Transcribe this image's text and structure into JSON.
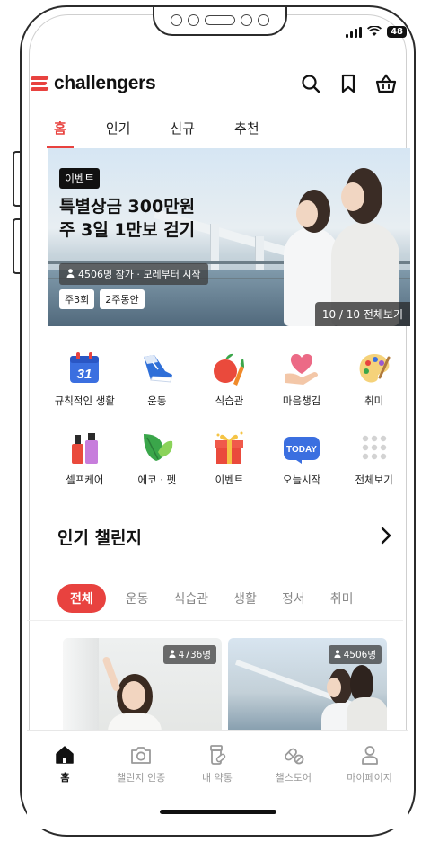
{
  "status": {
    "battery": "48"
  },
  "header": {
    "logo_text": "challengers",
    "brand_color": "#e8423f",
    "icons": [
      "search-icon",
      "bookmark-icon",
      "basket-icon"
    ]
  },
  "tabs": [
    {
      "label": "홈",
      "active": true
    },
    {
      "label": "인기"
    },
    {
      "label": "신규"
    },
    {
      "label": "추천"
    }
  ],
  "banner": {
    "tag": "이벤트",
    "title_line1": "특별상금 300만원",
    "title_line2": "주 3일 1만보 걷기",
    "meta": "4506명 참가 · 모레부터 시작",
    "chips": [
      "주3회",
      "2주동안"
    ],
    "page_indicator": "10 / 10 전체보기"
  },
  "categories": [
    {
      "label": "규칙적인 생활",
      "icon": "calendar-icon",
      "calendar_day": "31"
    },
    {
      "label": "운동",
      "icon": "sneaker-icon"
    },
    {
      "label": "식습관",
      "icon": "apple-carrot-icon"
    },
    {
      "label": "마음챙김",
      "icon": "heart-hand-icon"
    },
    {
      "label": "취미",
      "icon": "palette-icon"
    },
    {
      "label": "셀프케어",
      "icon": "cosmetics-icon"
    },
    {
      "label": "에코 · 펫",
      "icon": "leaves-icon"
    },
    {
      "label": "이벤트",
      "icon": "gift-icon"
    },
    {
      "label": "오늘시작",
      "icon": "today-badge-icon",
      "badge_text": "TODAY"
    },
    {
      "label": "전체보기",
      "icon": "grid-dots-icon"
    }
  ],
  "popular": {
    "title": "인기 챌린지",
    "filters": [
      {
        "label": "전체",
        "active": true
      },
      {
        "label": "운동"
      },
      {
        "label": "식습관"
      },
      {
        "label": "생활"
      },
      {
        "label": "정서"
      },
      {
        "label": "취미"
      }
    ],
    "cards": [
      {
        "count": "4736명"
      },
      {
        "count": "4506명"
      }
    ]
  },
  "bottom_nav": [
    {
      "label": "홈",
      "icon": "home-icon",
      "active": true
    },
    {
      "label": "챌린지 인증",
      "icon": "camera-icon"
    },
    {
      "label": "내 약통",
      "icon": "pill-bottle-icon"
    },
    {
      "label": "챌스토어",
      "icon": "pill-capsule-icon"
    },
    {
      "label": "마이페이지",
      "icon": "person-icon"
    }
  ]
}
